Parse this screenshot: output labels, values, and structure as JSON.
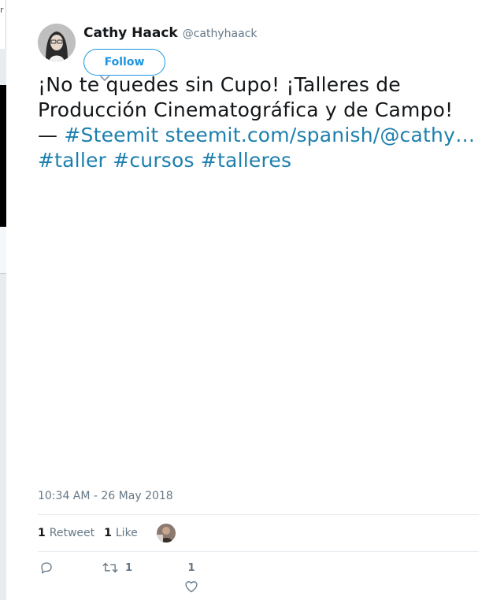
{
  "left_edge": {
    "glyph": "r"
  },
  "tweet": {
    "author": {
      "name": "Cathy Haack",
      "screen_name": "@cathyhaack"
    },
    "follow_label": "Follow",
    "text": {
      "plain": "¡No te quedes sin Cupo! ¡Talleres de Producción Cinematográfica y de Campo! — ",
      "links": [
        "#Steemit",
        "steemit.com/spanish/@cathy…",
        "#taller",
        "#cursos",
        "#talleres"
      ]
    },
    "timestamp": "10:34 AM - 26 May 2018",
    "stats": {
      "retweet_count": "1",
      "retweet_label": "Retweet",
      "like_count": "1",
      "like_label": "Like"
    },
    "actions": {
      "reply_count": "",
      "retweet_count": "1",
      "like_count": "1"
    }
  },
  "colors": {
    "link": "#1d7fae",
    "follow_blue": "#1b95e0",
    "text": "#14171a",
    "muted": "#657786"
  },
  "icons": [
    "reply-icon",
    "retweet-icon",
    "heart-icon",
    "caret-down-icon"
  ]
}
